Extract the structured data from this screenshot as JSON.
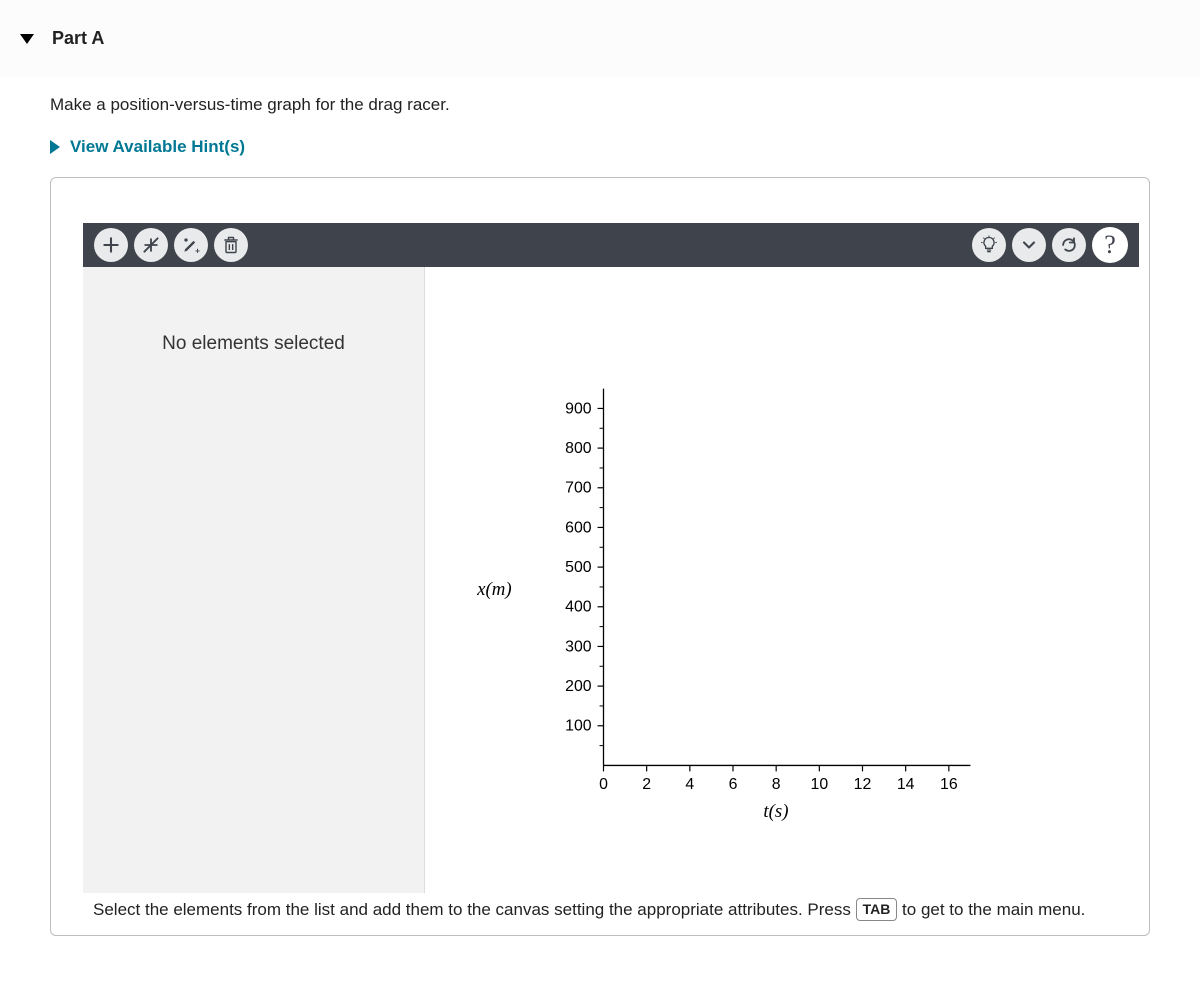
{
  "header": {
    "part_label": "Part A"
  },
  "instruction": "Make a position-versus-time graph for the drag racer.",
  "hints": {
    "label": "View Available Hint(s)"
  },
  "sidebar": {
    "empty_message": "No elements selected"
  },
  "chart_data": {
    "type": "scatter",
    "title": "",
    "xlabel": "t(s)",
    "ylabel": "x(m)",
    "x_ticks": [
      0,
      2,
      4,
      6,
      8,
      10,
      12,
      14,
      16
    ],
    "y_ticks": [
      100,
      200,
      300,
      400,
      500,
      600,
      700,
      800,
      900
    ],
    "xlim": [
      0,
      17
    ],
    "ylim": [
      0,
      950
    ],
    "series": []
  },
  "help": {
    "text_before": "Select the elements from the list and add them to the canvas setting the appropriate attributes. Press ",
    "key": "TAB",
    "text_after": " to get to the main menu."
  }
}
